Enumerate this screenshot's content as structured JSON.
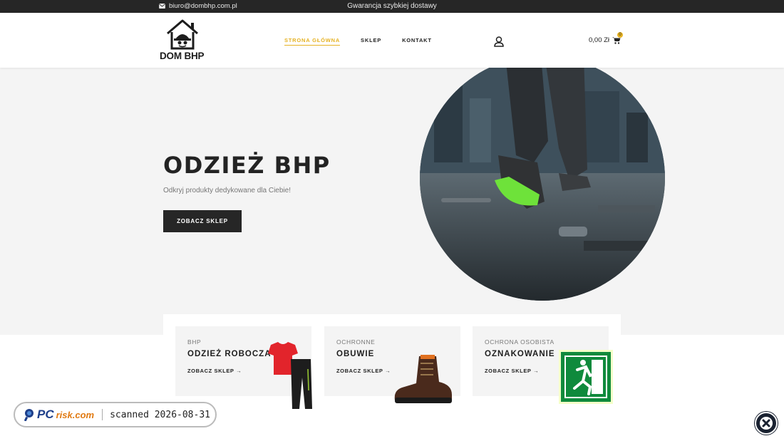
{
  "topbar": {
    "email": "biuro@dombhp.com.pl",
    "promo": "Gwarancja szybkiej dostawy"
  },
  "header": {
    "logo_text": "DOM BHP",
    "nav": [
      "STRONA GŁÓWNA",
      "SKLEP",
      "KONTAKT"
    ],
    "active_nav": "STRONA GŁÓWNA",
    "cart_total": "0,00 Zł",
    "cart_count": "0"
  },
  "hero": {
    "title": "ODZIEŻ BHP",
    "subtitle": "Odkryj produkty dedykowane dla Ciebie!",
    "cta": "ZOBACZ SKLEP"
  },
  "categories": [
    {
      "kicker": "BHP",
      "title": "ODZIEŻ ROBOCZA",
      "link": "ZOBACZ SKLEP →"
    },
    {
      "kicker": "OCHRONNE",
      "title": "OBUWIE",
      "link": "ZOBACZ SKLEP →"
    },
    {
      "kicker": "OCHRONA OSOBISTA",
      "title": "OZNAKOWANIE",
      "link": "ZOBACZ SKLEP →"
    }
  ],
  "watermark": {
    "brand": "PC",
    "brand_suffix": "risk.com",
    "scan_text": "scanned 2026-08-31"
  },
  "colors": {
    "accent": "#e6b223",
    "dark": "#262626",
    "hero_bg": "#f4f4f4"
  },
  "icons": [
    "envelope-icon",
    "house-helmet-logo",
    "user-icon",
    "cart-icon",
    "close-icon"
  ]
}
